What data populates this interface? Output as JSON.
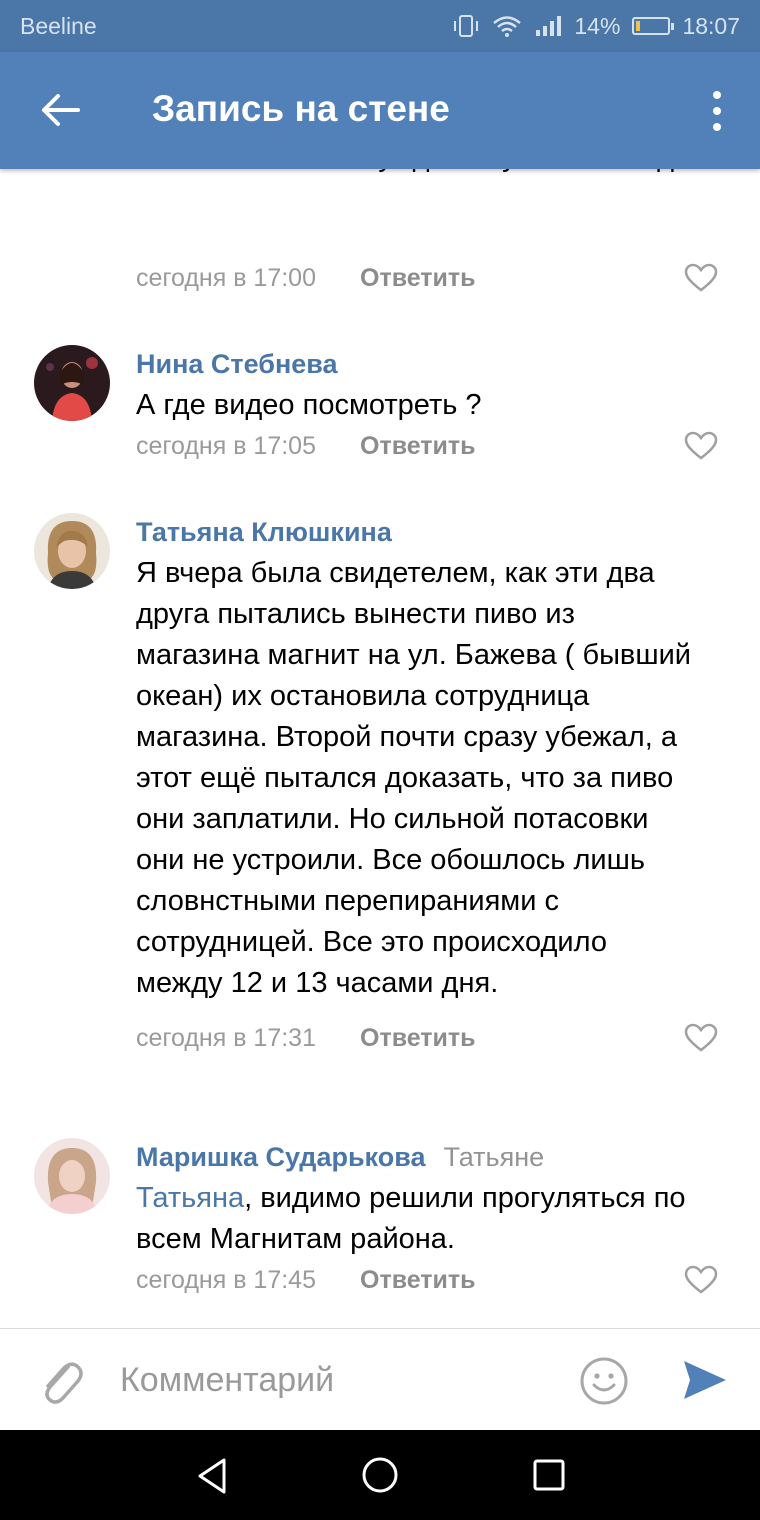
{
  "status_bar": {
    "carrier": "Beeline",
    "battery_percent": "14%",
    "battery_level": 0.14,
    "time": "18:07"
  },
  "header": {
    "title": "Запись на стене",
    "back_icon": "arrow-left-icon",
    "menu_icon": "more-vertical-icon"
  },
  "comments": [
    {
      "text": "отказывать в возбуждении уголовного дела",
      "time": "сегодня в 17:00",
      "reply_label": "Ответить",
      "like_icon": "heart-outline-icon"
    },
    {
      "author": "Нина Стебнева",
      "text": "А где видео посмотреть ?",
      "time": "сегодня в 17:05",
      "reply_label": "Ответить",
      "like_icon": "heart-outline-icon"
    },
    {
      "author": "Татьяна Клюшкина",
      "text": "Я вчера была свидетелем, как эти два друга пытались вынести пиво из магазина магнит на ул. Бажева ( бывший океан) их остановила сотрудница магазина. Второй почти сразу убежал, а этот ещё пытался доказать, что за пиво они заплатили. Но сильной потасовки они не устроили. Все обошлось лишь словнстными перепираниями с сотрудницей. Все это происходило между 12 и 13 часами дня.",
      "time": "сегодня в 17:31",
      "reply_label": "Ответить",
      "like_icon": "heart-outline-icon"
    },
    {
      "author": "Маришка Сударькова",
      "reply_to": "Татьяне",
      "mention": "Татьяна",
      "text": ", видимо решили прогуляться по всем Магнитам района.",
      "time": "сегодня в 17:45",
      "reply_label": "Ответить",
      "like_icon": "heart-outline-icon"
    }
  ],
  "composer": {
    "placeholder": "Комментарий",
    "value": "",
    "attach_icon": "paperclip-icon",
    "emoji_icon": "smiley-icon",
    "send_icon": "send-icon"
  },
  "nav_bar": {
    "back_icon": "triangle-back-icon",
    "home_icon": "circle-home-icon",
    "recent_icon": "square-recent-icon"
  },
  "colors": {
    "status_bar": "#4a76a8",
    "app_bar": "#5181b8",
    "link": "#4a76a8",
    "secondary_text": "#9a9a9a",
    "send": "#5181b8"
  }
}
